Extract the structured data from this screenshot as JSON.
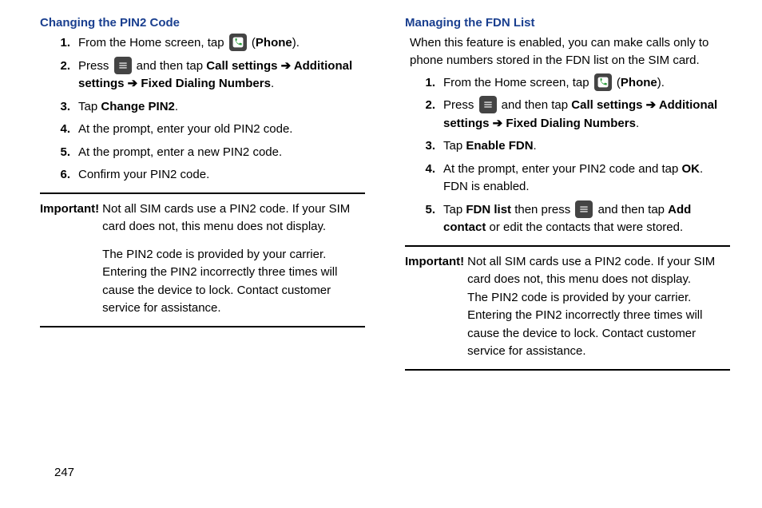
{
  "left": {
    "heading": "Changing the PIN2 Code",
    "steps": {
      "s1a": "From the Home screen, tap ",
      "s1b": " (",
      "s1c": "Phone",
      "s1d": ").",
      "s2a": "Press ",
      "s2b": " and then tap ",
      "s2c": "Call settings",
      "s2arrow1": " ➔ ",
      "s2d": "Additional settings",
      "s2arrow2": " ➔ ",
      "s2e": "Fixed Dialing Numbers",
      "s2f": ".",
      "s3a": "Tap ",
      "s3b": "Change PIN2",
      "s3c": ".",
      "s4": "At the prompt, enter your old PIN2 code.",
      "s5": "At the prompt, enter a new PIN2 code.",
      "s6": "Confirm your PIN2 code."
    },
    "important_label": "Important!",
    "important_p1": "Not all SIM cards use a PIN2 code. If your SIM card does not, this menu does not display.",
    "important_p2": "The PIN2 code is provided by your carrier. Entering the PIN2 incorrectly three times will cause the device to lock. Contact customer service for assistance."
  },
  "right": {
    "heading": "Managing the FDN List",
    "intro": "When this feature is enabled, you can make calls only to phone numbers stored in the FDN list on the SIM card.",
    "steps": {
      "s1a": "From the Home screen, tap ",
      "s1b": " (",
      "s1c": "Phone",
      "s1d": ").",
      "s2a": "Press ",
      "s2b": " and then tap ",
      "s2c": "Call settings",
      "s2arrow1": " ➔ ",
      "s2d": "Additional settings",
      "s2arrow2": " ➔ ",
      "s2e": "Fixed Dialing Numbers",
      "s2f": ".",
      "s3a": "Tap ",
      "s3b": "Enable FDN",
      "s3c": ".",
      "s4a": "At the prompt, enter your PIN2 code and tap ",
      "s4b": "OK",
      "s4c": ". FDN is enabled.",
      "s5a": "Tap ",
      "s5b": "FDN list",
      "s5c": " then press ",
      "s5d": " and then tap ",
      "s5e": "Add contact",
      "s5f": " or edit the contacts that were stored."
    },
    "important_label": "Important!",
    "important_p1": "Not all SIM cards use a PIN2 code. If your SIM card does not, this menu does not display.",
    "important_p2": "The PIN2 code is provided by your carrier. Entering the PIN2 incorrectly three times will cause the device to lock. Contact customer service for assistance."
  },
  "nums": {
    "n1": "1.",
    "n2": "2.",
    "n3": "3.",
    "n4": "4.",
    "n5": "5.",
    "n6": "6."
  },
  "page_number": "247"
}
